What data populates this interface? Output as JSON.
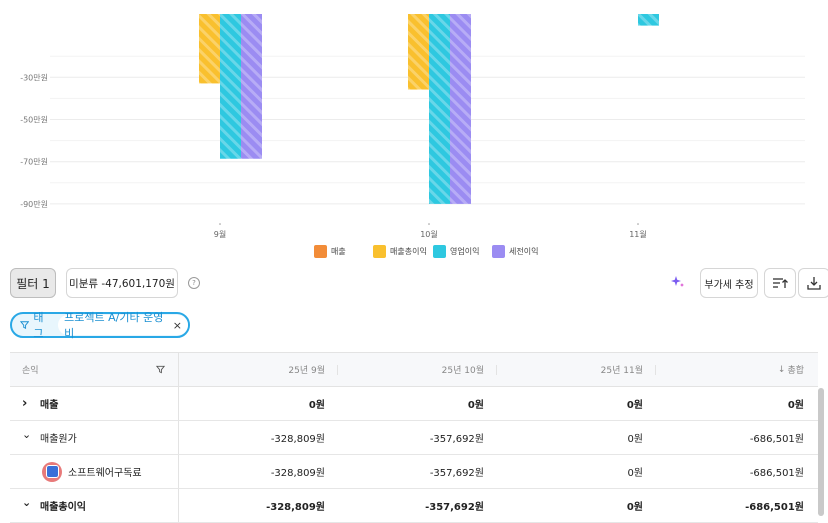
{
  "chart_data": {
    "type": "bar",
    "categories": [
      "9월",
      "10월",
      "11월"
    ],
    "ylim": [
      -100,
      0
    ],
    "yticks": [
      "-30만원",
      "-50만원",
      "-70만원",
      "-90만원"
    ],
    "ytick_values": [
      -30,
      -50,
      -70,
      -90
    ],
    "series": [
      {
        "name": "매출",
        "color": "#f28c38",
        "values": [
          0,
          0,
          0
        ]
      },
      {
        "name": "매출총이익",
        "color": "#f9c02e",
        "values": [
          -32.9,
          -35.8,
          0
        ]
      },
      {
        "name": "영업이익",
        "color": "#2ec8e0",
        "values": [
          -68.6,
          -90,
          -5.5
        ]
      },
      {
        "name": "세전이익",
        "color": "#9b8cf2",
        "values": [
          -68.6,
          -90,
          0
        ]
      }
    ],
    "legend_position": "bottom-center",
    "grid": true
  },
  "toolbar": {
    "filter_label": "필터 1",
    "unclassified_label": "미분류 -47,601,170원",
    "help_glyph": "?",
    "vat_label": "부가세 추정"
  },
  "tag_filter": {
    "label": "태그",
    "value": "프로젝트 A/기타 운영비",
    "close_glyph": "×"
  },
  "table": {
    "headers": {
      "account": "손익",
      "col1": "25년 9월",
      "col2": "25년 10월",
      "col3": "25년 11월",
      "total": "총합"
    },
    "rows": [
      {
        "label": "매출",
        "chevron": "›",
        "values": [
          "0원",
          "0원",
          "0원",
          "0원"
        ]
      },
      {
        "label": "매출원가",
        "chevron": "⌄",
        "values": [
          "-328,809원",
          "-357,692원",
          "0원",
          "-686,501원"
        ]
      },
      {
        "label": "소프트웨어구독료",
        "chevron": "",
        "values": [
          "-328,809원",
          "-357,692원",
          "0원",
          "-686,501원"
        ]
      },
      {
        "label": "매출총이익",
        "chevron": "⌄",
        "values": [
          "-328,809원",
          "-357,692원",
          "0원",
          "-686,501원"
        ]
      }
    ]
  }
}
